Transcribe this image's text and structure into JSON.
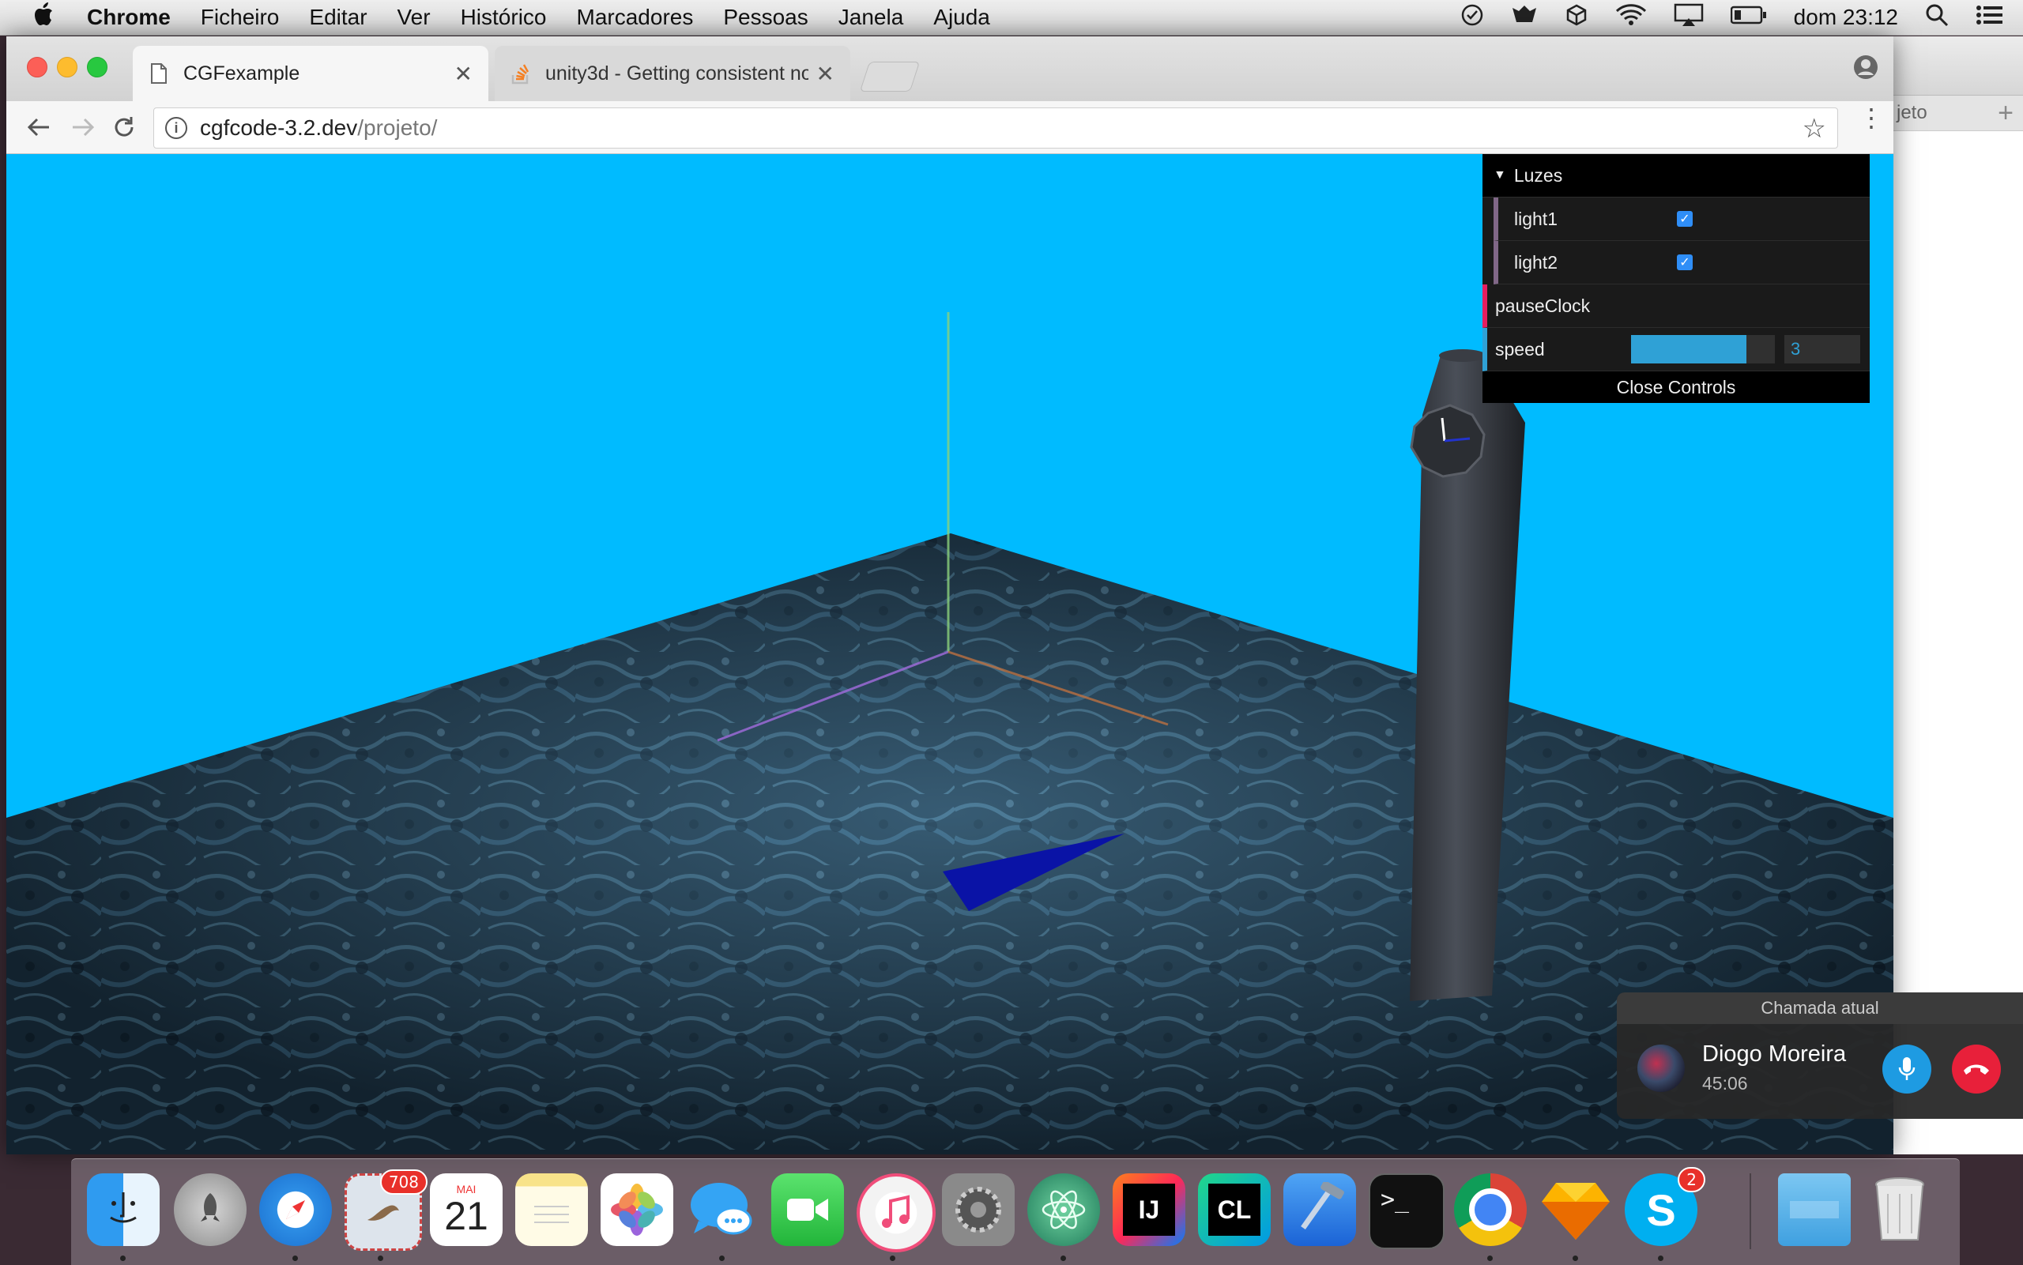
{
  "menubar": {
    "app": "Chrome",
    "items": [
      "Ficheiro",
      "Editar",
      "Ver",
      "Histórico",
      "Marcadores",
      "Pessoas",
      "Janela",
      "Ajuda"
    ],
    "clock": "dom 23:12"
  },
  "browser": {
    "tabs": [
      {
        "title": "CGFexample",
        "active": true
      },
      {
        "title": "unity3d - Getting consistent no",
        "active": false
      }
    ],
    "url_host": "cgfcode-3.2.dev",
    "url_path": "/projeto/",
    "background_tab_fragment": "jeto"
  },
  "gui": {
    "folder": "Luzes",
    "controls": [
      {
        "label": "light1",
        "type": "boolean",
        "checked": true
      },
      {
        "label": "light2",
        "type": "boolean",
        "checked": true
      },
      {
        "label": "pauseClock",
        "type": "function"
      },
      {
        "label": "speed",
        "type": "number",
        "value": "3",
        "slider_fraction": 0.8
      }
    ],
    "close_label": "Close Controls"
  },
  "call": {
    "title": "Chamada atual",
    "caller": "Diogo Moreira",
    "duration": "45:06"
  },
  "dock": {
    "apps": [
      {
        "name": "Finder",
        "icon": "finder-icon"
      },
      {
        "name": "Launchpad",
        "icon": "rocket-icon"
      },
      {
        "name": "Safari",
        "icon": "compass-icon"
      },
      {
        "name": "Mail",
        "icon": "mail-icon",
        "badge": "708"
      },
      {
        "name": "Calendar",
        "icon": "calendar-icon",
        "month": "MAI",
        "day": "21"
      },
      {
        "name": "Notes",
        "icon": "notes-icon"
      },
      {
        "name": "Photos",
        "icon": "photos-icon"
      },
      {
        "name": "Messages",
        "icon": "messages-icon"
      },
      {
        "name": "FaceTime",
        "icon": "facetime-icon"
      },
      {
        "name": "iTunes",
        "icon": "music-icon"
      },
      {
        "name": "System Preferences",
        "icon": "gear-icon"
      },
      {
        "name": "Atom",
        "icon": "atom-icon"
      },
      {
        "name": "IntelliJ IDEA",
        "icon": "intellij-icon",
        "label": "IJ"
      },
      {
        "name": "CLion",
        "icon": "clion-icon",
        "label": "CL"
      },
      {
        "name": "Xcode",
        "icon": "xcode-icon"
      },
      {
        "name": "Terminal",
        "icon": "terminal-icon",
        "label": ">_"
      },
      {
        "name": "Chrome",
        "icon": "chrome-icon"
      },
      {
        "name": "Sketch",
        "icon": "sketch-icon"
      },
      {
        "name": "Skype",
        "icon": "skype-icon",
        "label": "S",
        "badge": "2"
      },
      {
        "name": "Downloads",
        "icon": "folder-icon"
      },
      {
        "name": "Trash",
        "icon": "trash-icon"
      }
    ]
  },
  "colors": {
    "sky": "#00bbff",
    "gui_bool": "#806787",
    "gui_func": "#e61d5f",
    "gui_number": "#2fa1d6"
  }
}
